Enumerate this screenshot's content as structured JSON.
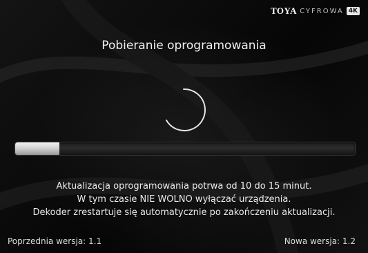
{
  "brand": {
    "logo_text": "TOYA",
    "sub_text": "CYFROWA",
    "badge": "4K"
  },
  "title": "Pobieranie oprogramowania",
  "progress": {
    "fraction": 0.13
  },
  "info": {
    "line1": "Aktualizacja oprogramowania potrwa od 10 do 15 minut.",
    "line2": "W tym czasie  NIE WOLNO  wyłączać urządzenia.",
    "line3": "Dekoder zrestartuje się automatycznie po zakończeniu aktualizacji."
  },
  "footer": {
    "previous_version": "Poprzednia wersja: 1.1",
    "new_version": "Nowa wersja: 1.2"
  },
  "colors": {
    "background": "#0b0b0b",
    "text": "#eaeaea",
    "progress_fill": "#d8d8d8"
  },
  "icons": {
    "spinner": "loading-spinner-icon"
  }
}
